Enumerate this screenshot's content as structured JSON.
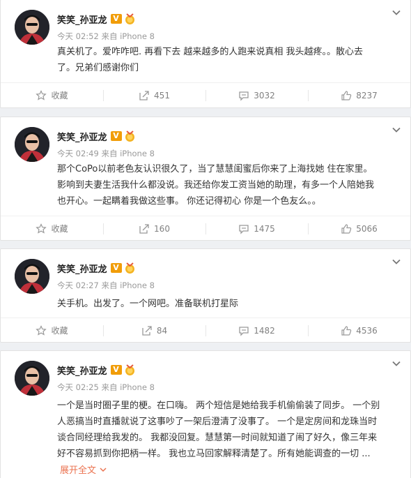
{
  "colors": {
    "link": "#eb7350",
    "muted": "#808080",
    "badge": "#f19d09"
  },
  "posts": [
    {
      "username": "笑笑_孙亚龙",
      "verified_badge": "V",
      "medal_icon": "medal-icon",
      "time": "今天 02:52 来自 iPhone 8",
      "text": "真关机了。爱咋咋吧. 再看下去 越来越多的人跑来说真相 我头越疼。。散心去\n了。兄弟们感谢你们",
      "actions": {
        "favorite": "收藏",
        "repost": "451",
        "comment": "3032",
        "like": "8237"
      }
    },
    {
      "username": "笑笑_孙亚龙",
      "verified_badge": "V",
      "medal_icon": "medal-icon",
      "time": "今天 02:49 来自 iPhone 8",
      "text": "那个CoPo以前老色友认识很久了，当了慧慧闺蜜后你来了上海找她 住在家里。\n影响到夫妻生活我什么都没说。我还给你发工资当她的助理，有多一个人陪她我\n也开心。一起瞒着我做这些事。   你还记得初心 你是一个色友么。。",
      "actions": {
        "favorite": "收藏",
        "repost": "160",
        "comment": "1475",
        "like": "5066"
      }
    },
    {
      "username": "笑笑_孙亚龙",
      "verified_badge": "V",
      "medal_icon": "medal-icon",
      "time": "今天 02:27 来自 iPhone 8",
      "text": "关手机。出发了。一个网吧。准备联机打星际",
      "actions": {
        "favorite": "收藏",
        "repost": "84",
        "comment": "1482",
        "like": "4536"
      }
    },
    {
      "username": "笑笑_孙亚龙",
      "verified_badge": "V",
      "medal_icon": "medal-icon",
      "time": "今天 02:25 来自 iPhone 8",
      "text": "一个是当时圈子里的梗。在口嗨。 两个短信是她给我手机偷偷装了同步。 一个别\n人恶搞当时直播就说了这事吵了一架后澄清了没事了。 一个是定房间和龙珠当时\n谈合同经理给我发的。  我都没回复。慧慧第一时间就知道了闹了好久，像三年来\n好不容易抓到你把柄一样。 我也立马回家解释清楚了。所有她能调查的一切 ...",
      "expand": "展开全文"
    }
  ]
}
